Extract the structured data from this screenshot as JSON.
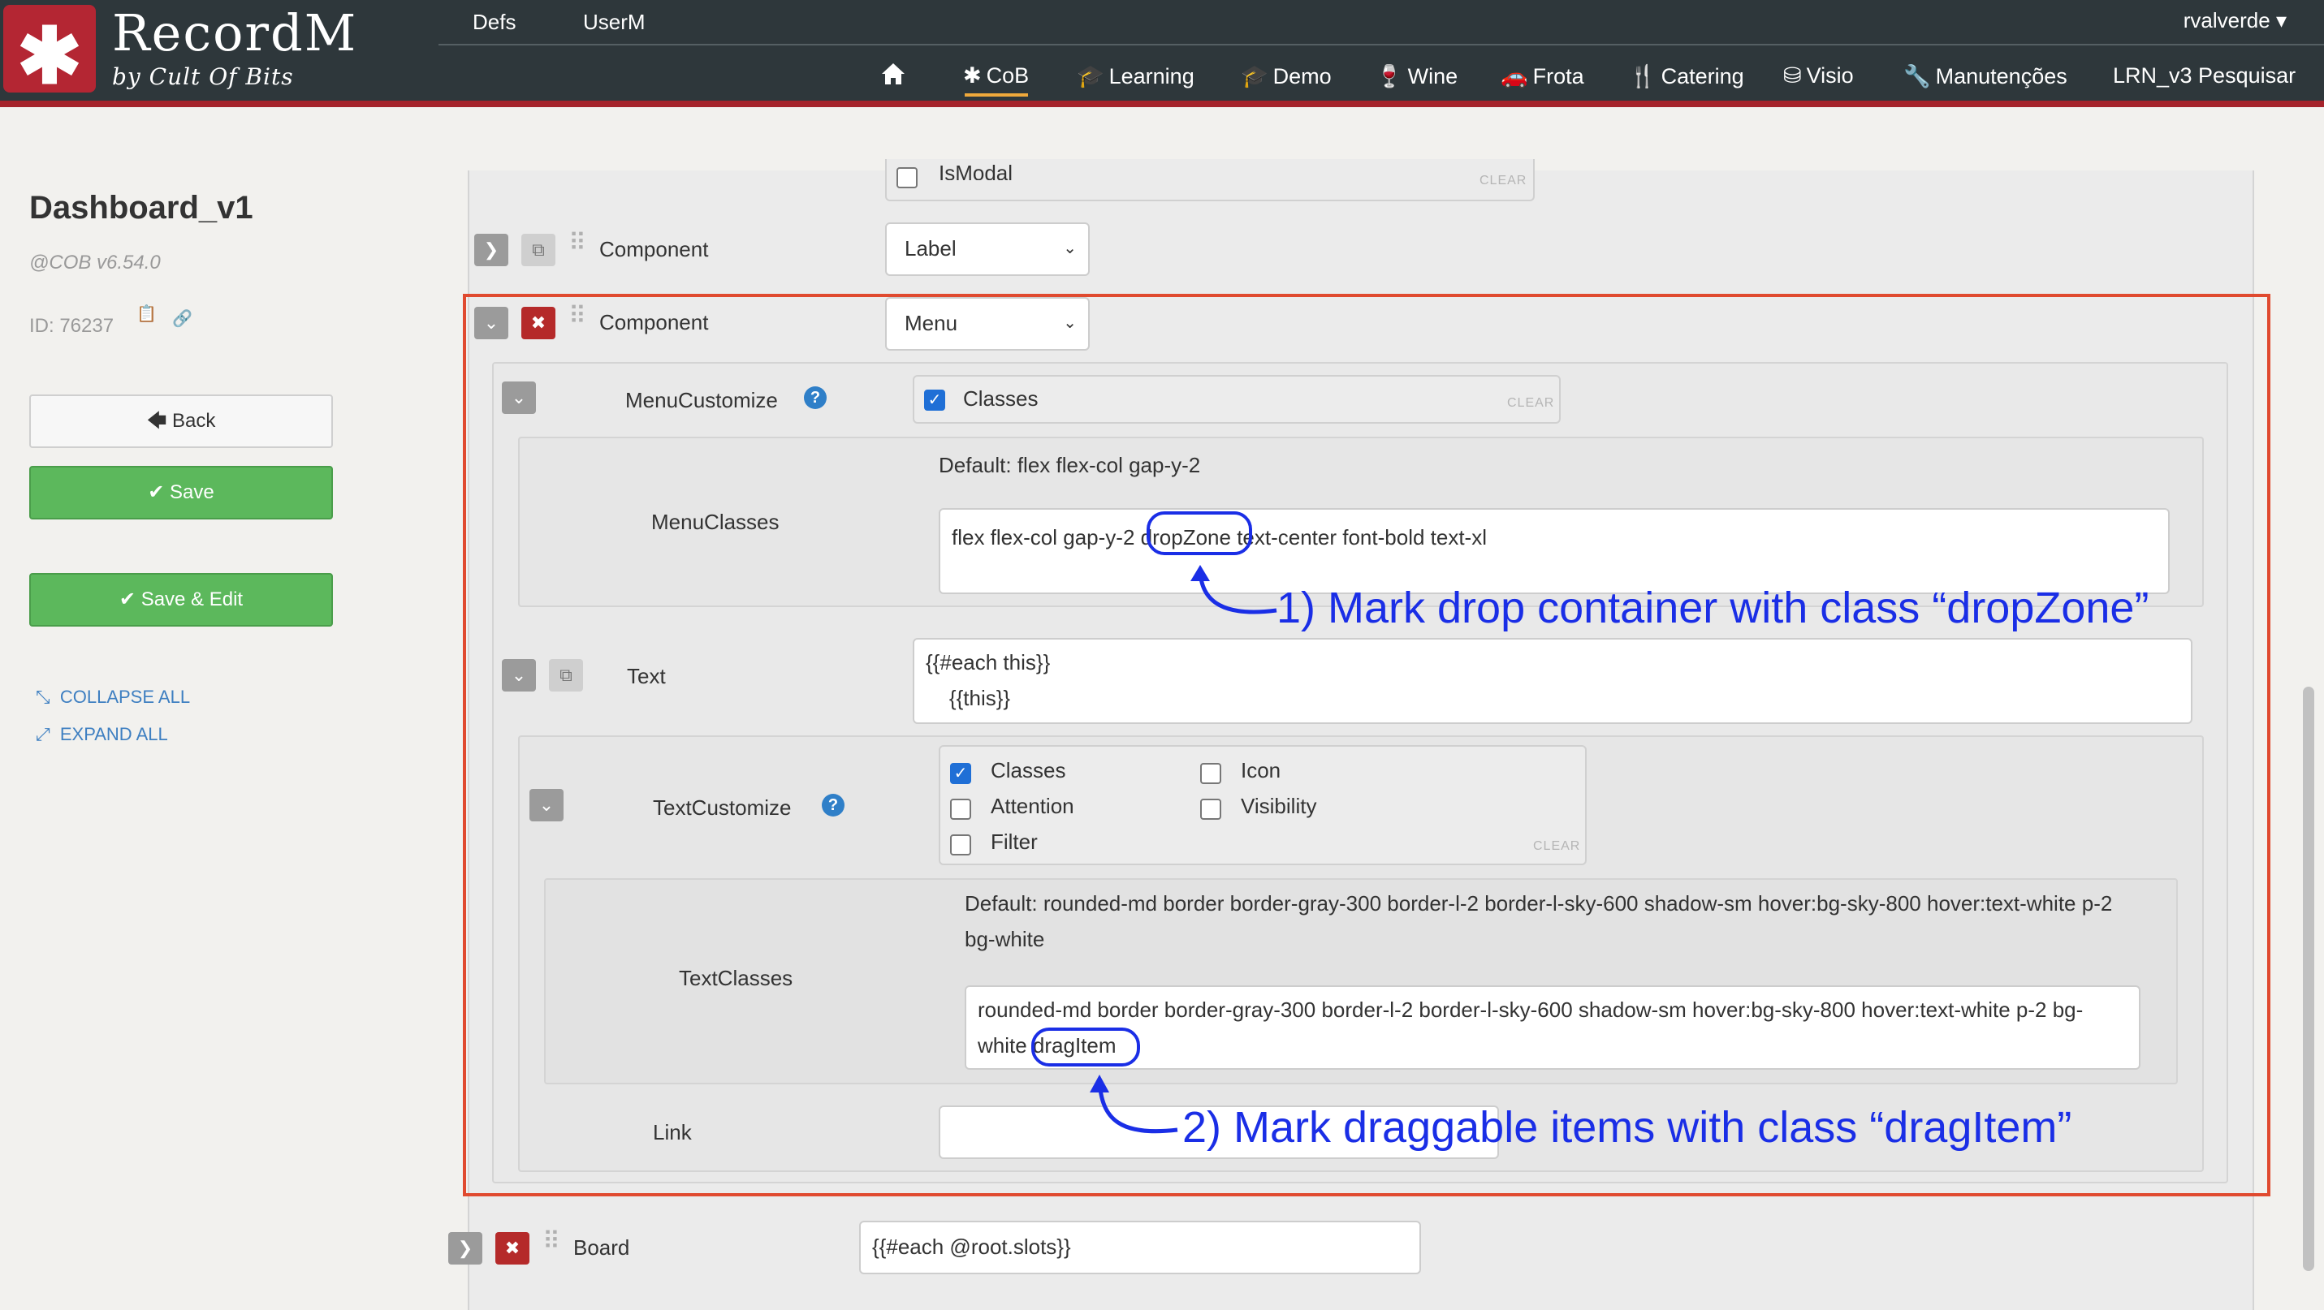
{
  "header": {
    "brand": "RecordM",
    "byline": "by Cult Of Bits",
    "top_nav": [
      "Defs",
      "UserM"
    ],
    "user": "rvalverde",
    "main_nav": [
      {
        "icon": "home-icon",
        "label": ""
      },
      {
        "icon": "asterisk-icon",
        "label": "CoB"
      },
      {
        "icon": "graduation-cap-icon",
        "label": "Learning"
      },
      {
        "icon": "graduation-cap-icon",
        "label": "Demo"
      },
      {
        "icon": "wine-glass-icon",
        "label": "Wine"
      },
      {
        "icon": "car-icon",
        "label": "Frota"
      },
      {
        "icon": "cutlery-icon",
        "label": "Catering"
      },
      {
        "icon": "database-icon",
        "label": "Visio"
      },
      {
        "icon": "wrench-icon",
        "label": "Manutenções"
      },
      {
        "icon": "",
        "label": "LRN_v3 Pesquisar"
      }
    ],
    "active_nav": "CoB"
  },
  "sidebar": {
    "title": "Dashboard_v1",
    "version": "@COB v6.54.0",
    "id_text": "ID: 76237",
    "back_label": "Back",
    "save_label": "Save",
    "save_edit_label": "Save & Edit",
    "collapse_all": "COLLAPSE ALL",
    "expand_all": "EXPAND ALL"
  },
  "form": {
    "ismodal_label": "IsModal",
    "clear_label": "CLEAR",
    "component1": {
      "label": "Component",
      "value": "Label"
    },
    "component2": {
      "label": "Component",
      "value": "Menu"
    },
    "menu_customize": {
      "label": "MenuCustomize",
      "option": "Classes",
      "checked": true
    },
    "menu_classes": {
      "label": "MenuClasses",
      "default": "Default: flex flex-col gap-y-2",
      "value_before": "flex flex-col gap-y-2 ",
      "value_mark": "dropZone",
      "value_after": " text-center font-bold text-xl"
    },
    "text": {
      "label": "Text",
      "line1": "{{#each this}}",
      "line2": "    {{this}}"
    },
    "text_customize": {
      "label": "TextCustomize",
      "options": [
        {
          "label": "Classes",
          "checked": true
        },
        {
          "label": "Icon",
          "checked": false
        },
        {
          "label": "Attention",
          "checked": false
        },
        {
          "label": "Visibility",
          "checked": false
        },
        {
          "label": "Filter",
          "checked": false
        }
      ]
    },
    "text_classes": {
      "label": "TextClasses",
      "default_line1": "Default: rounded-md border border-gray-300 border-l-2 border-l-sky-600 shadow-sm hover:bg-sky-800 hover:text-white p-2",
      "default_line2": "bg-white",
      "value_line1": "rounded-md border border-gray-300 border-l-2 border-l-sky-600 shadow-sm hover:bg-sky-800 hover:text-white p-2 bg-",
      "value_line2_before": "white ",
      "value_mark": "dragItem"
    },
    "link": {
      "label": "Link",
      "value": ""
    },
    "board": {
      "label": "Board",
      "value": "{{#each @root.slots}}"
    }
  },
  "annotations": {
    "note1": "1) Mark drop container with class “dropZone”",
    "note2": "2) Mark draggable items with class “dragItem”"
  },
  "colors": {
    "topbar": "#2e373b",
    "brand_red": "#b42633",
    "save_green": "#5cb85c",
    "annotation_blue": "#1a2ee6",
    "highlight_box": "#e04a2f",
    "active_underline": "#f0a93b"
  }
}
